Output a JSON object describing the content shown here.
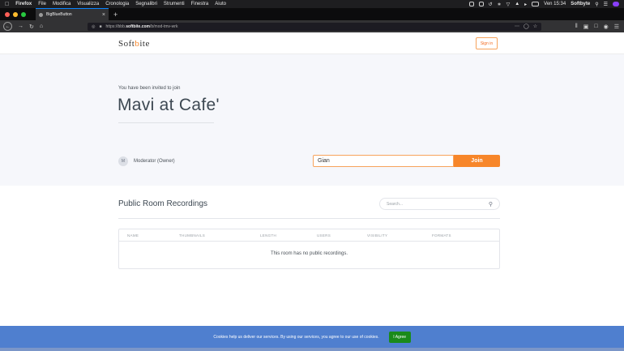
{
  "menubar": {
    "app": "Firefox",
    "items": [
      "File",
      "Modifica",
      "Visualizza",
      "Cronologia",
      "Segnalibri",
      "Strumenti",
      "Finestra",
      "Aiuto"
    ],
    "clock": "Ven 15:34",
    "user": "Softbyte"
  },
  "browser": {
    "tab_title": "BigBlueButton",
    "url_prefix": "https://bbb.",
    "url_domain": "softbite.com",
    "url_path": "/b/mod-tmv-wrk"
  },
  "header": {
    "logo_left": "Soft",
    "logo_o": "b",
    "logo_right": "ite",
    "signin_label": "Sign in"
  },
  "hero": {
    "invited_text": "You have been invited to join",
    "room_name": "Mavi at Cafe'",
    "owner_initial": "M",
    "owner_label": "Moderator (Owner)",
    "name_value": "Gian",
    "join_label": "Join"
  },
  "recordings": {
    "title": "Public Room Recordings",
    "search_placeholder": "Search...",
    "columns": [
      "NAME",
      "THUMBNAILS",
      "LENGTH",
      "USERS",
      "VISIBILITY",
      "FORMATS"
    ],
    "empty_message": "This room has no public recordings."
  },
  "cookie": {
    "text": "Cookies help us deliver our services. By using our services, you agree to our use of cookies.",
    "agree_label": "I Agree"
  },
  "colors": {
    "accent": "#f7862a",
    "cookie_bg": "#4f7fcf",
    "agree_bg": "#1a8a1a"
  }
}
